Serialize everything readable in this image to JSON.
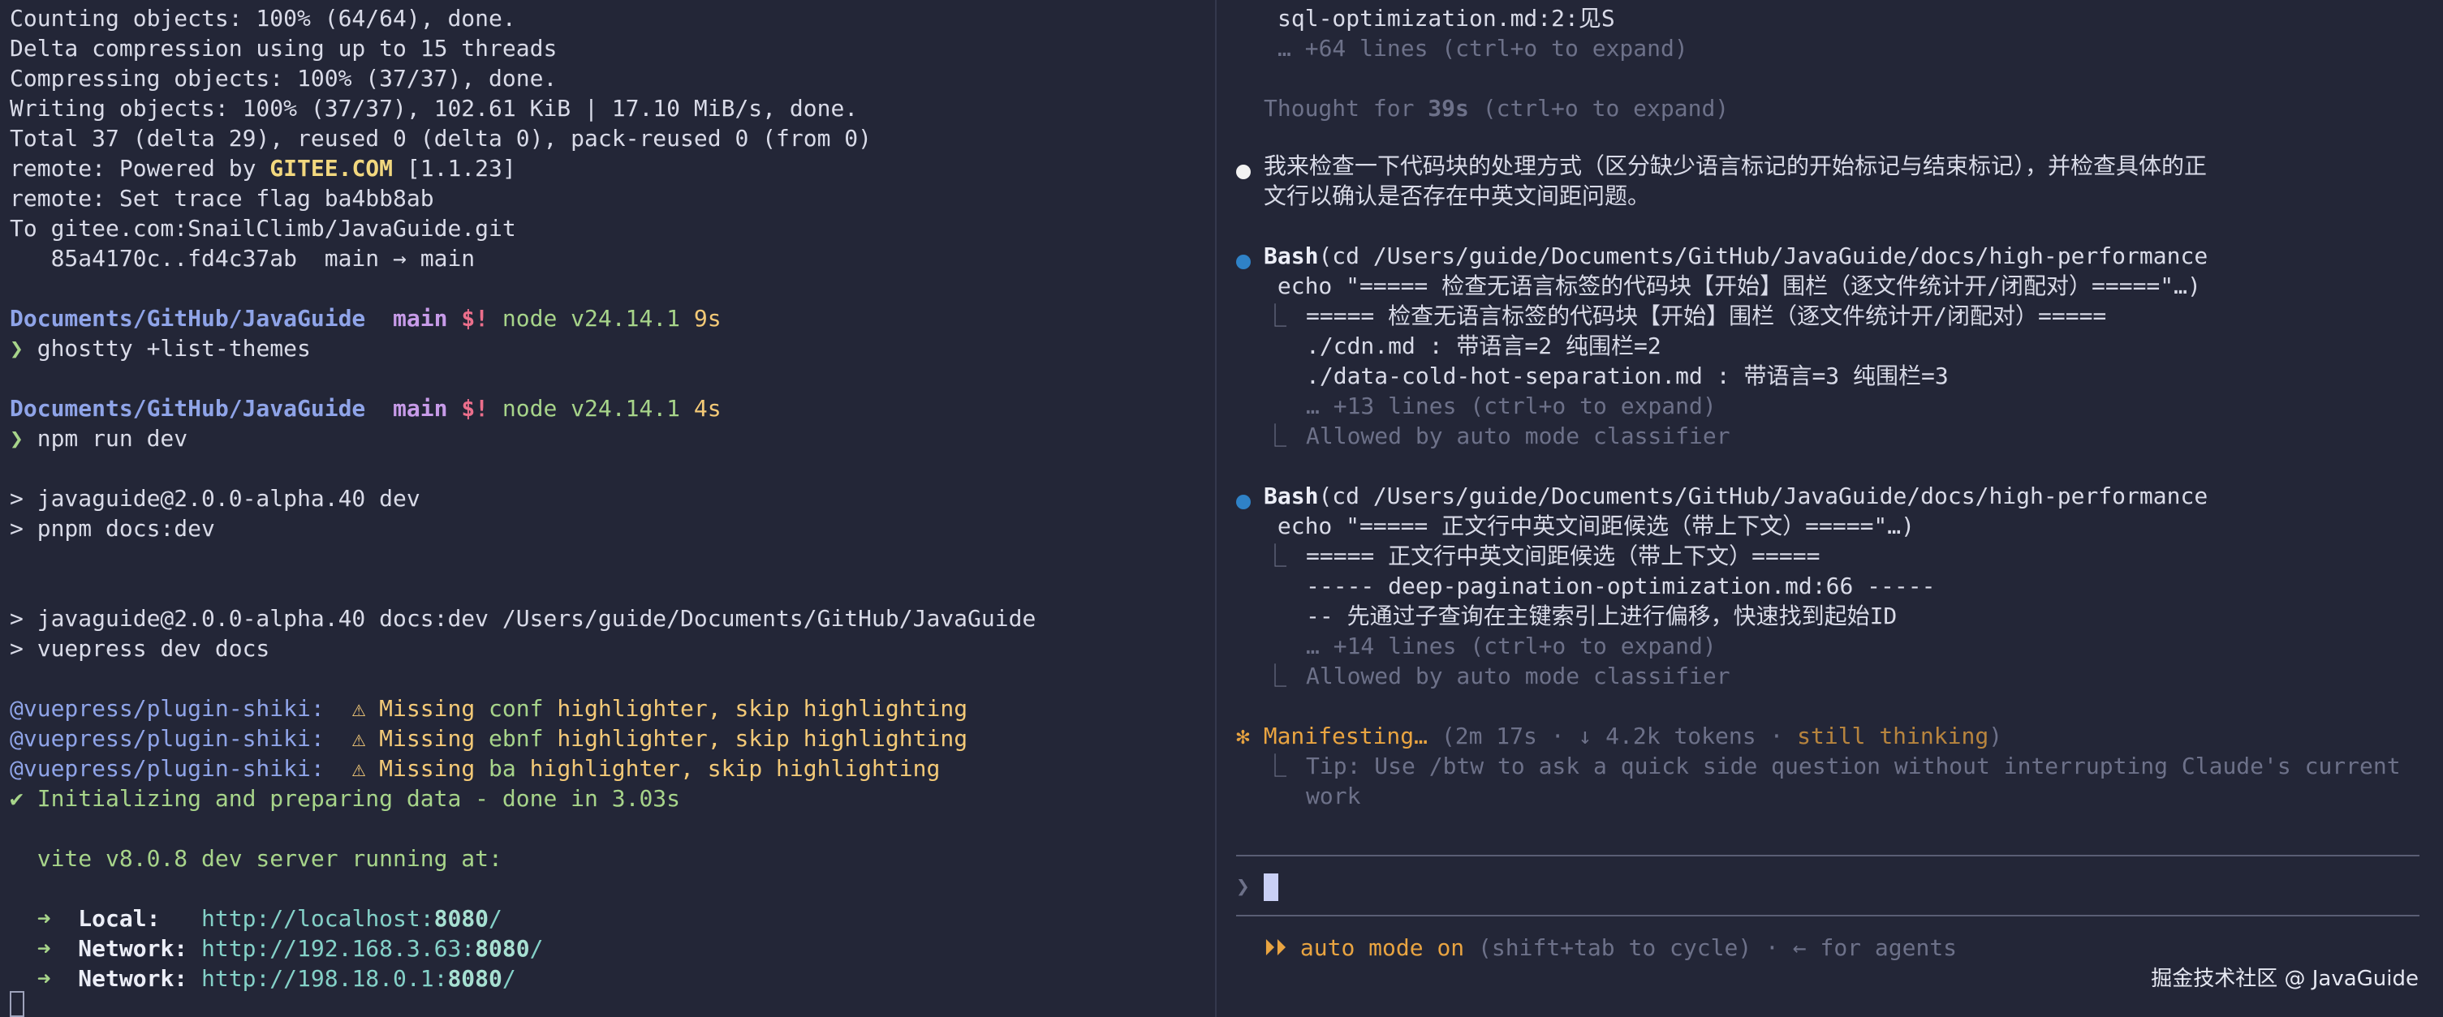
{
  "left": {
    "git": [
      "Counting objects: 100% (64/64), done.",
      "Delta compression using up to 15 threads",
      "Compressing objects: 100% (37/37), done.",
      "Writing objects: 100% (37/37), 102.61 KiB | 17.10 MiB/s, done.",
      "Total 37 (delta 29), reused 0 (delta 0), pack-reused 0 (from 0)"
    ],
    "remote_prefix": "remote: Powered by ",
    "remote_host": "GITEE.COM",
    "remote_version": " [1.1.23]",
    "trace": "remote: Set trace flag ba4bb8ab",
    "to": "To gitee.com:SnailClimb/JavaGuide.git",
    "refs": "   85a4170c..fd4c37ab  main → main",
    "prompts": [
      {
        "path": "Documents/GitHub/JavaGuide",
        "branch_icon": "",
        "branch": "main",
        "status": "$!",
        "node": "node v24.14.1",
        "time": "9s",
        "arrow": "❯",
        "cmd": "ghostty +list-themes"
      },
      {
        "path": "Documents/GitHub/JavaGuide",
        "branch_icon": "",
        "branch": "main",
        "status": "$!",
        "node": "node v24.14.1",
        "time": "4s",
        "arrow": "❯",
        "cmd": "npm run dev"
      }
    ],
    "npm": [
      "> javaguide@2.0.0-alpha.40 dev",
      "> pnpm docs:dev",
      "> javaguide@2.0.0-alpha.40 docs:dev /Users/guide/Documents/GitHub/JavaGuide",
      "> vuepress dev docs"
    ],
    "plugin": "@vuepress/plugin-shiki:",
    "warnings": [
      {
        "icon": "⚠",
        "pre": " Missing ",
        "lang": "conf",
        "post": " highlighter, skip highlighting"
      },
      {
        "icon": "⚠",
        "pre": " Missing ",
        "lang": "ebnf",
        "post": " highlighter, skip highlighting"
      },
      {
        "icon": "⚠",
        "pre": " Missing ",
        "lang": "ba",
        "post": " highlighter, skip highlighting"
      }
    ],
    "init": "✔ Initializing and preparing data - done in 3.03s",
    "vite": "  vite v8.0.8 dev server running at:",
    "servers": [
      {
        "arrow": "➜",
        "label": "Local:",
        "pad": "   ",
        "url": "http://localhost:",
        "port": "8080",
        "slash": "/"
      },
      {
        "arrow": "➜",
        "label": "Network:",
        "pad": " ",
        "url": "http://192.168.3.63:",
        "port": "8080",
        "slash": "/"
      },
      {
        "arrow": "➜",
        "label": "Network:",
        "pad": " ",
        "url": "http://198.18.0.1:",
        "port": "8080",
        "slash": "/"
      }
    ]
  },
  "right": {
    "top1": "sql-optimization.md:2:见S",
    "top2": "… +64 lines (ctrl+o to expand)",
    "thought_pre": "Thought for ",
    "thought_time": "39s",
    "thought_post": " (ctrl+o to expand)",
    "msg1": "我来检查一下代码块的处理方式（区分缺少语言标记的开始标记与结束标记），并检查具体的正",
    "msg2": "文行以确认是否存在中英文间距问题。",
    "bash_label": "Bash",
    "tool1": {
      "cmd": "(cd /Users/guide/Documents/GitHub/JavaGuide/docs/high-performance",
      "cmd2": " echo \"===== 检查无语言标签的代码块【开始】围栏（逐文件统计开/闭配对）=====\"…)",
      "corner": "⎿",
      "out": [
        "===== 检查无语言标签的代码块【开始】围栏（逐文件统计开/闭配对）=====",
        "./cdn.md : 带语言=2 纯围栏=2",
        "./data-cold-hot-separation.md : 带语言=3 纯围栏=3"
      ],
      "more": "… +13 lines (ctrl+o to expand)",
      "allowed": "Allowed by auto mode classifier"
    },
    "tool2": {
      "cmd": "(cd /Users/guide/Documents/GitHub/JavaGuide/docs/high-performance",
      "cmd2": " echo \"===== 正文行中英文间距候选（带上下文）=====\"…)",
      "corner": "⎿",
      "out": [
        "===== 正文行中英文间距候选（带上下文）=====",
        "----- deep-pagination-optimization.md:66 -----",
        "-- 先通过子查询在主键索引上进行偏移，快速找到起始ID"
      ],
      "more": "… +14 lines (ctrl+o to expand)",
      "allowed": "Allowed by auto mode classifier"
    },
    "status": {
      "star": "✻",
      "word": "Manifesting…",
      "detail_pre": " (2m 17s · ↓ 4.2k tokens · ",
      "still": "still thinking",
      "detail_post": ")",
      "corner": "⎿",
      "tip1": "Tip: Use /btw to ask a quick side question without interrupting Claude's current",
      "tip2": "work"
    },
    "input_prompt": "❯",
    "mode_icon": "⏵⏵",
    "mode_label": "auto mode on",
    "mode_hint": " (shift+tab to cycle) · ← for agents"
  },
  "watermark": "掘金技术社区 @ JavaGuide",
  "colors": {
    "background": "#232637",
    "path": "#8fa4e8",
    "branch": "#c79be8",
    "status": "#ec6f8c",
    "node": "#a7d48a",
    "accent_orange": "#e9a441",
    "url": "#84d1c8"
  }
}
